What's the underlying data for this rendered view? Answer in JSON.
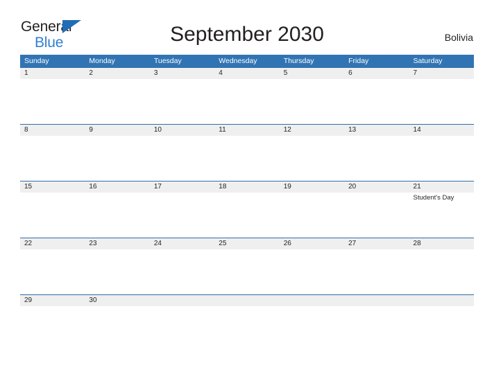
{
  "brand": {
    "name_top": "General",
    "name_bottom": "Blue",
    "flag_icon": "flag-triangle-icon",
    "accent_color": "#1f6db5",
    "bottom_color": "#2e7fd1"
  },
  "header": {
    "title": "September 2030",
    "country": "Bolivia"
  },
  "calendar": {
    "header_bg": "#3174b4",
    "daynum_bg": "#efefef",
    "rule_color": "#2e6ca8",
    "weekdays": [
      "Sunday",
      "Monday",
      "Tuesday",
      "Wednesday",
      "Thursday",
      "Friday",
      "Saturday"
    ],
    "weeks": [
      {
        "days": [
          {
            "num": "1",
            "events": []
          },
          {
            "num": "2",
            "events": []
          },
          {
            "num": "3",
            "events": []
          },
          {
            "num": "4",
            "events": []
          },
          {
            "num": "5",
            "events": []
          },
          {
            "num": "6",
            "events": []
          },
          {
            "num": "7",
            "events": []
          }
        ]
      },
      {
        "days": [
          {
            "num": "8",
            "events": []
          },
          {
            "num": "9",
            "events": []
          },
          {
            "num": "10",
            "events": []
          },
          {
            "num": "11",
            "events": []
          },
          {
            "num": "12",
            "events": []
          },
          {
            "num": "13",
            "events": []
          },
          {
            "num": "14",
            "events": []
          }
        ]
      },
      {
        "days": [
          {
            "num": "15",
            "events": []
          },
          {
            "num": "16",
            "events": []
          },
          {
            "num": "17",
            "events": []
          },
          {
            "num": "18",
            "events": []
          },
          {
            "num": "19",
            "events": []
          },
          {
            "num": "20",
            "events": []
          },
          {
            "num": "21",
            "events": [
              "Student's Day"
            ]
          }
        ]
      },
      {
        "days": [
          {
            "num": "22",
            "events": []
          },
          {
            "num": "23",
            "events": []
          },
          {
            "num": "24",
            "events": []
          },
          {
            "num": "25",
            "events": []
          },
          {
            "num": "26",
            "events": []
          },
          {
            "num": "27",
            "events": []
          },
          {
            "num": "28",
            "events": []
          }
        ]
      },
      {
        "days": [
          {
            "num": "29",
            "events": []
          },
          {
            "num": "30",
            "events": []
          },
          {
            "num": "",
            "events": []
          },
          {
            "num": "",
            "events": []
          },
          {
            "num": "",
            "events": []
          },
          {
            "num": "",
            "events": []
          },
          {
            "num": "",
            "events": []
          }
        ]
      }
    ]
  }
}
